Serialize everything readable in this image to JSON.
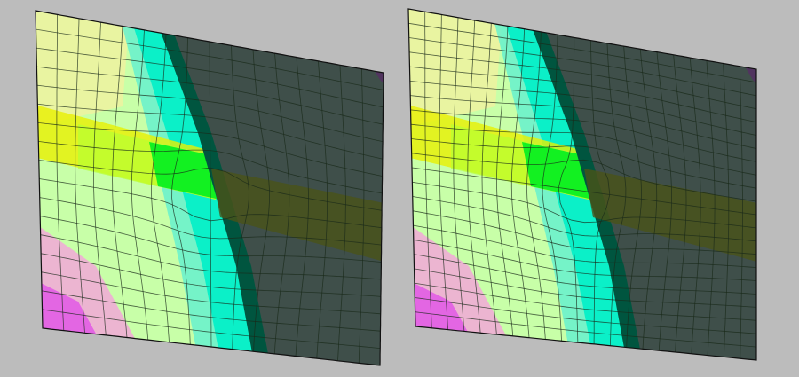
{
  "scene": {
    "background_color": "#bcbcbc",
    "panels": [
      {
        "id": "left",
        "grid": {
          "rows": 17,
          "cols": 16
        },
        "grid_line_color": "#1a2a1a",
        "outline_color": "#111111"
      },
      {
        "id": "right",
        "grid": {
          "rows": 22,
          "cols": 21
        },
        "grid_line_color": "#1a2a1a",
        "outline_color": "#111111"
      }
    ],
    "palette": {
      "magenta": "#e04ce8",
      "pink": "#f2a8d8",
      "pale_yellow": "#eef2a0",
      "yellow": "#e8f000",
      "lime": "#b8ff30",
      "green": "#00f020",
      "pale_green": "#c8ffa8",
      "cyan": "#00f0c8",
      "aqua": "#60f0d0",
      "teal_dark": "#00553f",
      "olive_dark": "#4a5218",
      "slate": "#3f4f4a",
      "purple_dark": "#5a2a68"
    }
  }
}
